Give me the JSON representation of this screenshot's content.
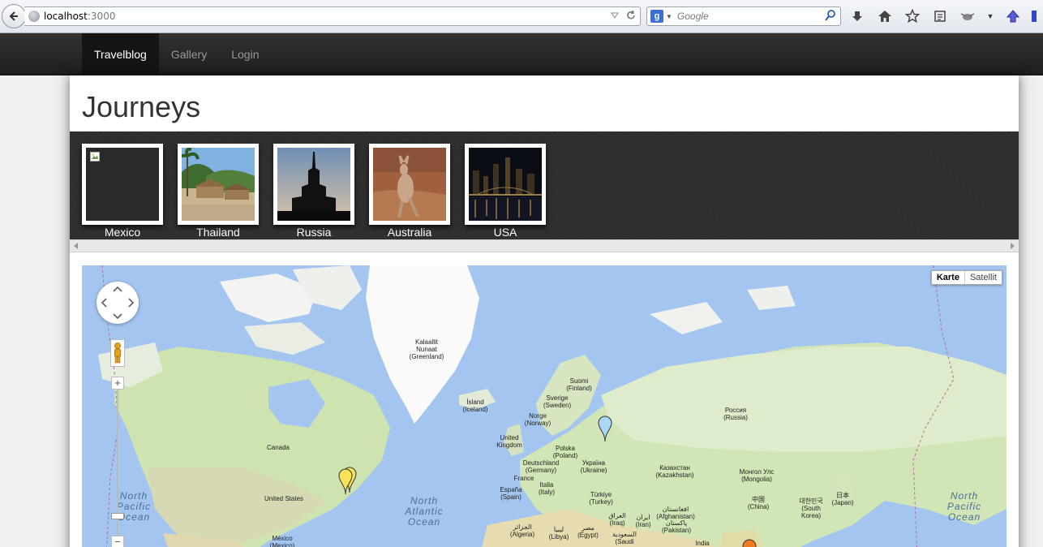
{
  "browser": {
    "url_host": "localhost",
    "url_port": ":3000",
    "search_placeholder": "Google",
    "search_engine_letter": "g"
  },
  "navbar": {
    "items": [
      {
        "label": "Travelblog",
        "active": true
      },
      {
        "label": "Gallery",
        "active": false
      },
      {
        "label": "Login",
        "active": false
      }
    ]
  },
  "page": {
    "title": "Journeys"
  },
  "journeys": [
    {
      "name": "Mexico",
      "image": "broken-image"
    },
    {
      "name": "Thailand",
      "image": "beach-huts-photo"
    },
    {
      "name": "Russia",
      "image": "tower-silhouette-photo"
    },
    {
      "name": "Australia",
      "image": "kangaroo-photo"
    },
    {
      "name": "USA",
      "image": "night-skyline-photo"
    }
  ],
  "map": {
    "type_buttons": [
      {
        "label": "Karte",
        "selected": true
      },
      {
        "label": "Satellit",
        "selected": false
      }
    ],
    "labels": [
      {
        "text": "Kalaallit\nNunaat\n(Greenland)"
      },
      {
        "text": "Suomi\n(Finland)"
      },
      {
        "text": "Sverige\n(Sweden)"
      },
      {
        "text": "Ísland\n(Iceland)"
      },
      {
        "text": "Norge\n(Norway)"
      },
      {
        "text": "United\nKingdom"
      },
      {
        "text": "Polska\n(Poland)"
      },
      {
        "text": "Deutschland\n(Germany)"
      },
      {
        "text": "Україна\n(Ukraine)"
      },
      {
        "text": "France"
      },
      {
        "text": "Italia\n(Italy)"
      },
      {
        "text": "España\n(Spain)"
      },
      {
        "text": "Türkiye\n(Turkey)"
      },
      {
        "text": "Россия\n(Russia)"
      },
      {
        "text": "Казахстан\n(Kazakhstan)"
      },
      {
        "text": "Монгол Улс\n(Mongolia)"
      },
      {
        "text": "中国\n(China)"
      },
      {
        "text": "대한민국\n(South\nKorea)"
      },
      {
        "text": "日本\n(Japan)"
      },
      {
        "text": "Canada"
      },
      {
        "text": "United States"
      },
      {
        "text": "México\n(Mexico)"
      },
      {
        "text": "الجزائر\n(Algeria)"
      },
      {
        "text": "ليبيا\n(Libya)"
      },
      {
        "text": "مصر\n(Egypt)"
      },
      {
        "text": "العراق\n(Iraq)"
      },
      {
        "text": "ایران\n(Iran)"
      },
      {
        "text": "افغانستان\n(Afghanistan)"
      },
      {
        "text": "پاکستان\n(Pakistan)"
      },
      {
        "text": "India"
      },
      {
        "text": "السعودية\n(Saudi"
      }
    ],
    "oceans": [
      {
        "text": "North\nPacific\nOcean"
      },
      {
        "text": "North\nAtlantic\nOcean"
      },
      {
        "text": "North\nPacific\nOcean"
      }
    ],
    "markers": [
      {
        "color": "#f7e35a"
      },
      {
        "color": "#f7e35a"
      },
      {
        "color": "#a9d7f5"
      },
      {
        "color": "#f07a1c"
      }
    ]
  }
}
